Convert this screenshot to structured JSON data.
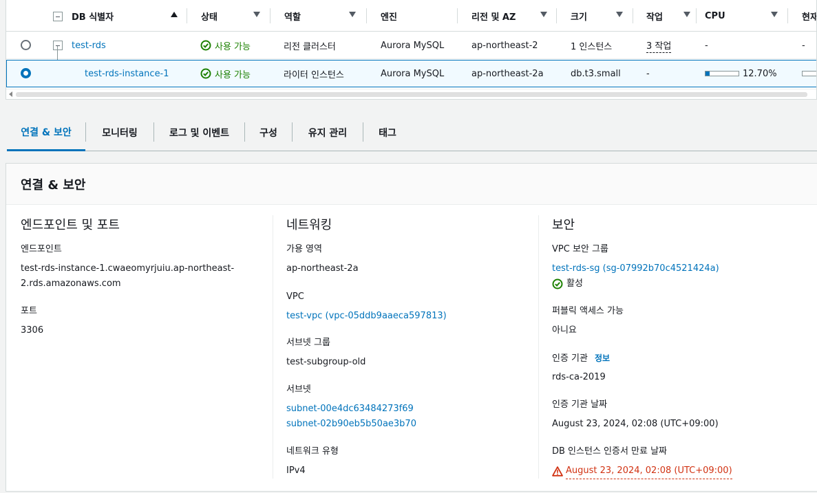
{
  "table": {
    "headers": [
      "DB 식별자",
      "상태",
      "역할",
      "엔진",
      "리전 및 AZ",
      "크기",
      "작업",
      "CPU",
      "현재"
    ],
    "rows": [
      {
        "identifier": "test-rds",
        "status": "사용 가능",
        "role": "리전 클러스터",
        "engine": "Aurora MySQL",
        "region": "ap-northeast-2",
        "size": "1 인스턴스",
        "actions": "3 작업",
        "cpu": "-",
        "current": "-"
      },
      {
        "identifier": "test-rds-instance-1",
        "status": "사용 가능",
        "role": "라이터 인스턴스",
        "engine": "Aurora MySQL",
        "region": "ap-northeast-2a",
        "size": "db.t3.small",
        "actions": "-",
        "cpu": "12.70%",
        "cpu_fraction": 0.127,
        "current": ""
      }
    ]
  },
  "tabs": [
    "연결 & 보안",
    "모니터링",
    "로그 및 이벤트",
    "구성",
    "유지 관리",
    "태그"
  ],
  "panel": {
    "title": "연결 & 보안",
    "endpoint_section": {
      "title": "엔드포인트 및 포트",
      "endpoint_label": "엔드포인트",
      "endpoint_line1": "test-rds-instance-1.cwaeomyrjuiu.ap-northeast-",
      "endpoint_line2": "2.rds.amazonaws.com",
      "port_label": "포트",
      "port_value": "3306"
    },
    "network_section": {
      "title": "네트워킹",
      "az_label": "가용 영역",
      "az_value": "ap-northeast-2a",
      "vpc_label": "VPC",
      "vpc_value": "test-vpc (vpc-05ddb9aaeca597813)",
      "subnet_group_label": "서브넷 그룹",
      "subnet_group_value": "test-subgroup-old",
      "subnets_label": "서브넷",
      "subnet_1": "subnet-00e4dc63484273f69",
      "subnet_2": "subnet-02b90eb5b50ae3b70",
      "network_type_label": "네트워크 유형",
      "network_type_value": "IPv4"
    },
    "security_section": {
      "title": "보안",
      "sg_label": "VPC 보안 그룹",
      "sg_value": "test-rds-sg (sg-07992b70c4521424a)",
      "sg_status": "활성",
      "public_label": "퍼블릭 액세스 가능",
      "public_value": "아니요",
      "ca_label": "인증 기관",
      "ca_info": "정보",
      "ca_value": "rds-ca-2019",
      "ca_date_label": "인증 기관 날짜",
      "ca_date_value": "August 23, 2024, 02:08 (UTC+09:00)",
      "cert_expiry_label": "DB 인스턴스 인증서 만료 날짜",
      "cert_expiry_value": "August 23, 2024, 02:08 (UTC+09:00)"
    }
  },
  "colors": {
    "link": "#0073bb",
    "success": "#1d8102",
    "error": "#d13212"
  }
}
